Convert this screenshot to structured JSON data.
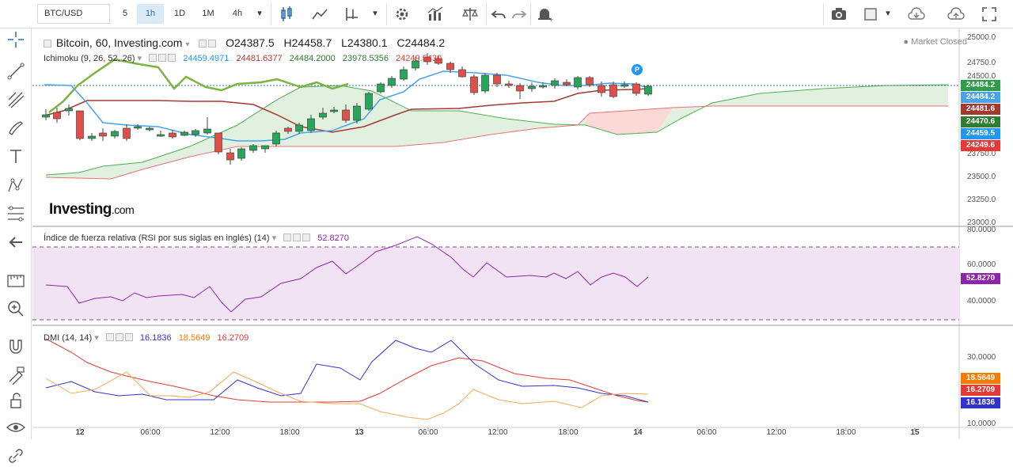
{
  "toolbar": {
    "symbol": "BTC/USD",
    "intervals": [
      "5",
      "1h",
      "1D",
      "1M",
      "4h"
    ],
    "active_interval": "1h"
  },
  "legend": {
    "title": "Bitcoin, 60, Investing.com",
    "open": "O24387.5",
    "high": "H24458.7",
    "low": "L24380.1",
    "close": "C24484.2",
    "market_status": "Market Closed"
  },
  "ichimoku": {
    "label": "Ichimoku (9, 26, 52, 26)",
    "values": [
      "24459.4971",
      "24481.6377",
      "24484.2000",
      "23978.5356",
      "24249.5430"
    ],
    "colors": [
      "#2196f3",
      "#b03a2e",
      "#2e7d32",
      "#2e7d32",
      "#e53935"
    ]
  },
  "rsi": {
    "label": "Índice de fuerza relativa (RSI por sus siglas en inglés) (14)",
    "value": "52.8270"
  },
  "dmi": {
    "label": "DMI (14, 14)",
    "values": [
      "16.1836",
      "18.5649",
      "16.2709"
    ],
    "colors": [
      "#3333cc",
      "#f57c00",
      "#e53935"
    ]
  },
  "logo": {
    "brand": "Investing",
    "suffix": ".com"
  },
  "price_axis": [
    "25000.0",
    "24750.0",
    "24500.0",
    "23750.0",
    "23500.0",
    "23250.0",
    "23000.0"
  ],
  "price_tags": [
    {
      "text": "24484.2",
      "color": "#2e9d4a"
    },
    {
      "text": "24484.2",
      "color": "#4aa3e8"
    },
    {
      "text": "24481.6",
      "color": "#a33a32"
    },
    {
      "text": "24470.6",
      "color": "#2e7d32"
    },
    {
      "text": "24459.5",
      "color": "#2196f3"
    },
    {
      "text": "24249.6",
      "color": "#e53935"
    }
  ],
  "rsi_axis": [
    "80.0000",
    "60.0000",
    "40.0000"
  ],
  "rsi_tag": {
    "text": "52.8270",
    "color": "#8e24aa"
  },
  "dmi_axis": [
    "30.0000",
    "10.0000"
  ],
  "dmi_tags": [
    {
      "text": "18.5649",
      "color": "#f57c00"
    },
    {
      "text": "16.2709",
      "color": "#e53935"
    },
    {
      "text": "16.1836",
      "color": "#3333cc"
    }
  ],
  "time_axis": [
    "12",
    "06:00",
    "12:00",
    "18:00",
    "13",
    "06:00",
    "12:00",
    "18:00",
    "14",
    "06:00",
    "12:00",
    "18:00",
    "15"
  ],
  "badge": "P",
  "colors": {
    "up": "#26a65b",
    "down": "#e0504a",
    "accent": "#2a6db3"
  }
}
